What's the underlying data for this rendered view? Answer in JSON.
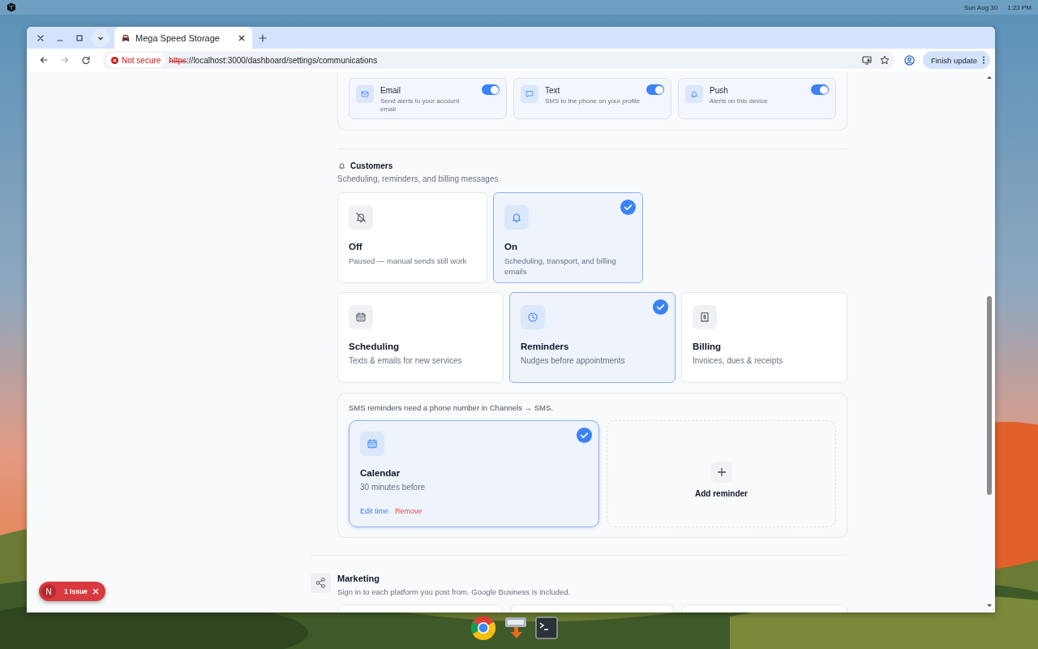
{
  "desktop": {
    "date": "Sun Aug 30",
    "time": "1:23 PM"
  },
  "browser": {
    "tab_title": "Mega Speed Storage",
    "security": "Not secure",
    "url_scheme": "https",
    "url_rest": "://localhost:3000/dashboard/settings/communications",
    "update_button": "Finish update"
  },
  "channels": [
    {
      "name": "Email",
      "description": "Send alerts to your account email",
      "on": true
    },
    {
      "name": "Text",
      "description": "SMS to the phone on your profile",
      "on": true
    },
    {
      "name": "Push",
      "description": "Alerts on this device",
      "on": true
    }
  ],
  "customers": {
    "title": "Customers",
    "description": "Scheduling, reminders, and billing messages.",
    "modes": [
      {
        "title": "Off",
        "description": "Paused — manual sends still work",
        "selected": false
      },
      {
        "title": "On",
        "description": "Scheduling, transport, and billing emails",
        "selected": true
      }
    ],
    "categories": [
      {
        "title": "Scheduling",
        "description": "Texts & emails for new services",
        "selected": false
      },
      {
        "title": "Reminders",
        "description": "Nudges before appointments",
        "selected": true
      },
      {
        "title": "Billing",
        "description": "Invoices, dues & receipts",
        "selected": false
      }
    ],
    "reminders": {
      "note": "SMS reminders need a phone number in Channels → SMS.",
      "items": [
        {
          "title": "Calendar",
          "description": "30 minutes before",
          "selected": true,
          "actions": [
            {
              "label": "Edit time",
              "kind": "edit"
            },
            {
              "label": "Remove",
              "kind": "danger"
            }
          ]
        }
      ],
      "add_label": "Add reminder"
    }
  },
  "marketing": {
    "title": "Marketing",
    "description": "Sign in to each platform you post from. Google Business is included."
  },
  "issues_badge": {
    "avatar": "N",
    "label": "1 Issue"
  }
}
